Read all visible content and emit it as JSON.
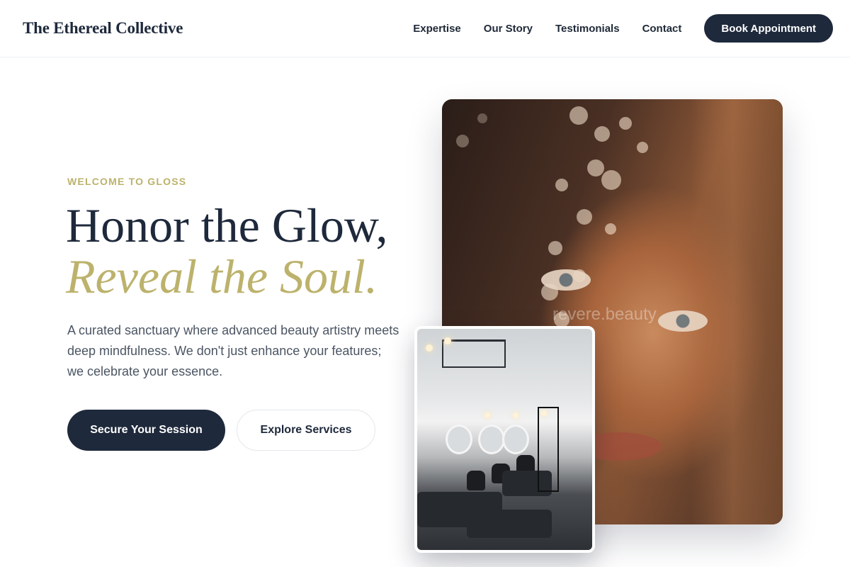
{
  "header": {
    "logo": "The Ethereal Collective",
    "nav": [
      "Expertise",
      "Our Story",
      "Testimonials",
      "Contact"
    ],
    "cta": "Book Appointment"
  },
  "hero": {
    "eyebrow": "WELCOME TO GLOSS",
    "headline_line1": "Honor the Glow,",
    "headline_line2": "Reveal the Soul.",
    "description": "A curated sanctuary where advanced beauty artistry meets deep mindfulness. We don't just enhance your features; we celebrate your essence.",
    "primary_button": "Secure Your Session",
    "secondary_button": "Explore Services"
  },
  "images": {
    "main_watermark": "revere.beauty"
  },
  "colors": {
    "navy": "#1e293b",
    "gold": "#bcb26c",
    "body_text": "#4b5563"
  }
}
